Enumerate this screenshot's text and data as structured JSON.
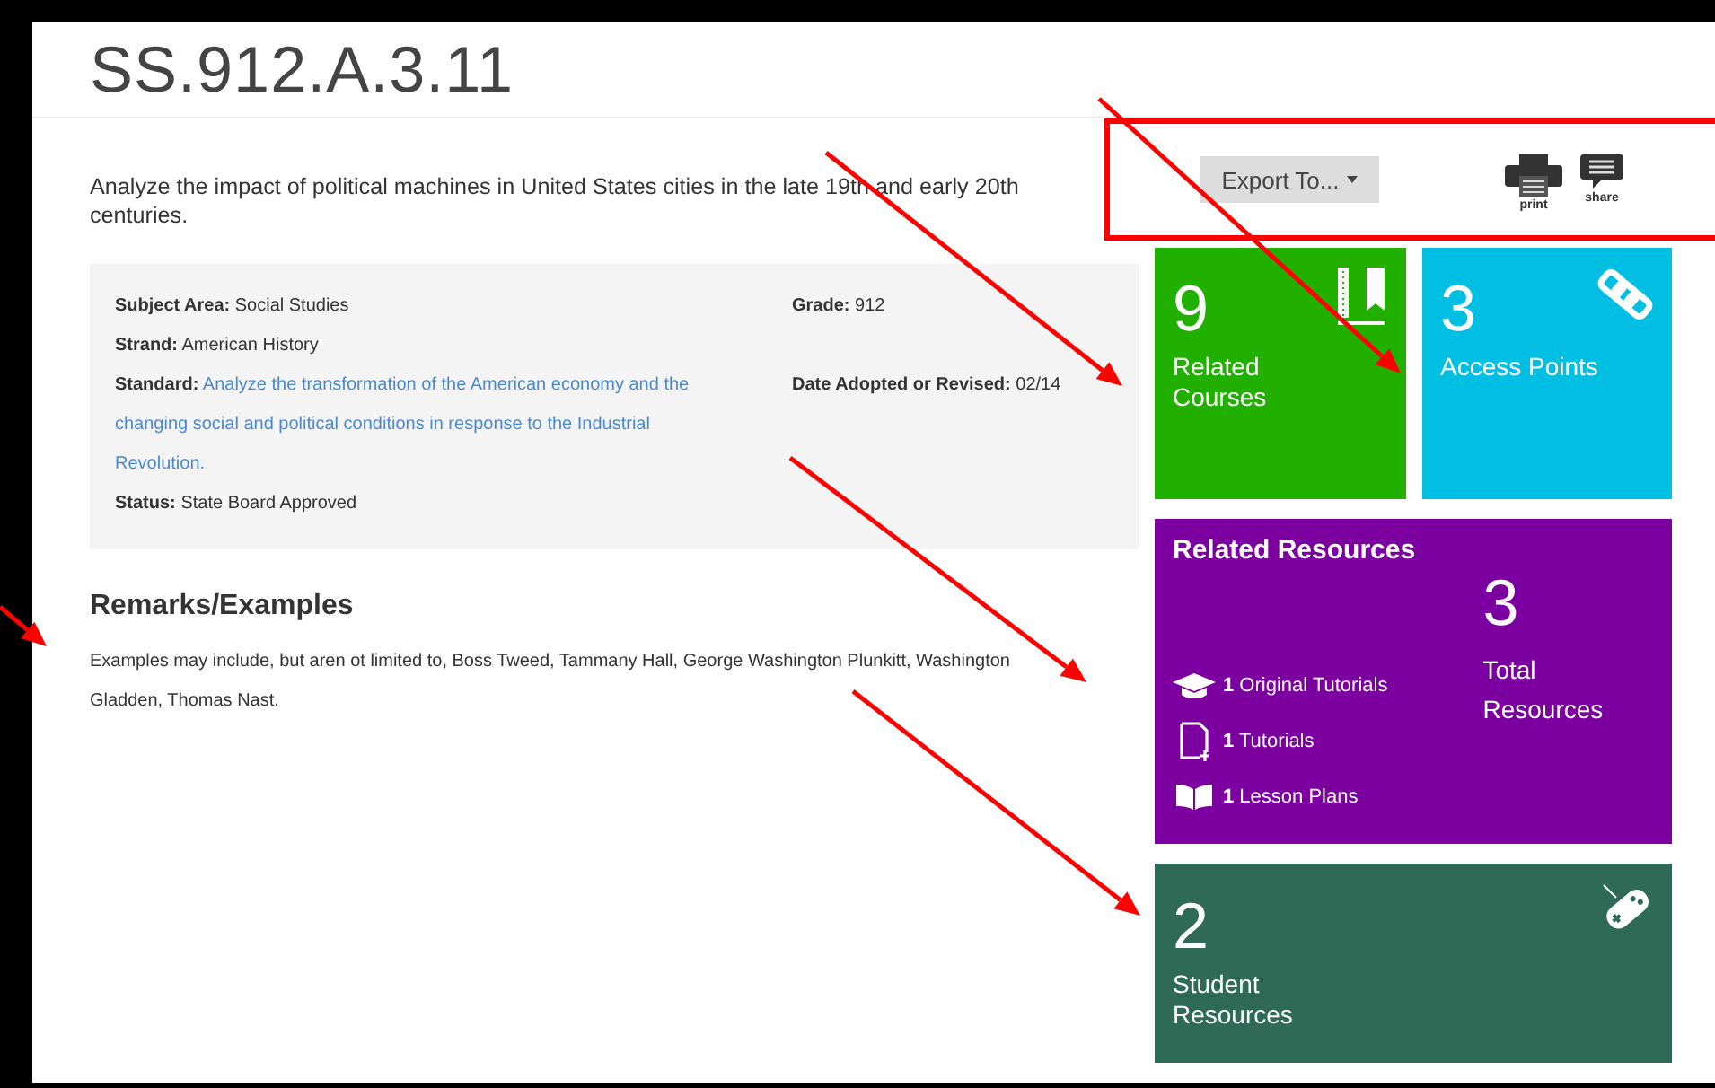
{
  "title": "SS.912.A.3.11",
  "description": "Analyze the impact of political machines in United States cities in the late 19th and early 20th centuries.",
  "details": {
    "left": [
      {
        "label": "Subject Area:",
        "value": "Social Studies",
        "kind": "text"
      },
      {
        "label": "Strand:",
        "value": "American History",
        "kind": "text"
      },
      {
        "label": "Standard:",
        "value": "Analyze the transformation of the American economy and the changing social and political conditions in response to the Industrial Revolution.",
        "kind": "link"
      },
      {
        "label": "Status:",
        "value": "State Board Approved",
        "kind": "text"
      }
    ],
    "right": [
      {
        "label": "Grade:",
        "value": "912",
        "kind": "text"
      },
      {
        "label": "Date Adopted or Revised:",
        "value": "02/14",
        "kind": "text"
      }
    ]
  },
  "remarks": {
    "heading": "Remarks/Examples",
    "text": "Examples may include, but aren ot limited to, Boss Tweed, Tammany Hall, George Washington Plunkitt, Washington Gladden, Thomas Nast."
  },
  "toolbar": {
    "export_button": "Export To...",
    "actions": [
      {
        "label": "print",
        "kind": "print"
      },
      {
        "label": "share",
        "kind": "share"
      }
    ]
  },
  "tiles": [
    {
      "count": "9",
      "label": "Related Courses",
      "kind": "book",
      "color": "#22b000"
    },
    {
      "count": "3",
      "label": "Access Points",
      "kind": "chain",
      "color": "#00bfe3"
    }
  ],
  "related_resources": {
    "title": "Related Resources",
    "color": "#7b009f",
    "items": [
      {
        "text": "**1** Original Tutorials",
        "kind": "cap"
      },
      {
        "text": "**1** Tutorials",
        "kind": "doc"
      },
      {
        "text": "**1** Lesson Plans",
        "kind": "book"
      }
    ],
    "total": "3",
    "total_label": "Total Resources"
  },
  "student_resources": {
    "count": "2",
    "label": "Student Resources",
    "kind": "gamepad",
    "color": "#2e6a55"
  },
  "annotations": [
    {
      "kind": "box"
    },
    {
      "kind": "arrow"
    },
    {
      "kind": "arrow"
    },
    {
      "kind": "arrow"
    },
    {
      "kind": "arrow"
    },
    {
      "kind": "arrow"
    }
  ]
}
